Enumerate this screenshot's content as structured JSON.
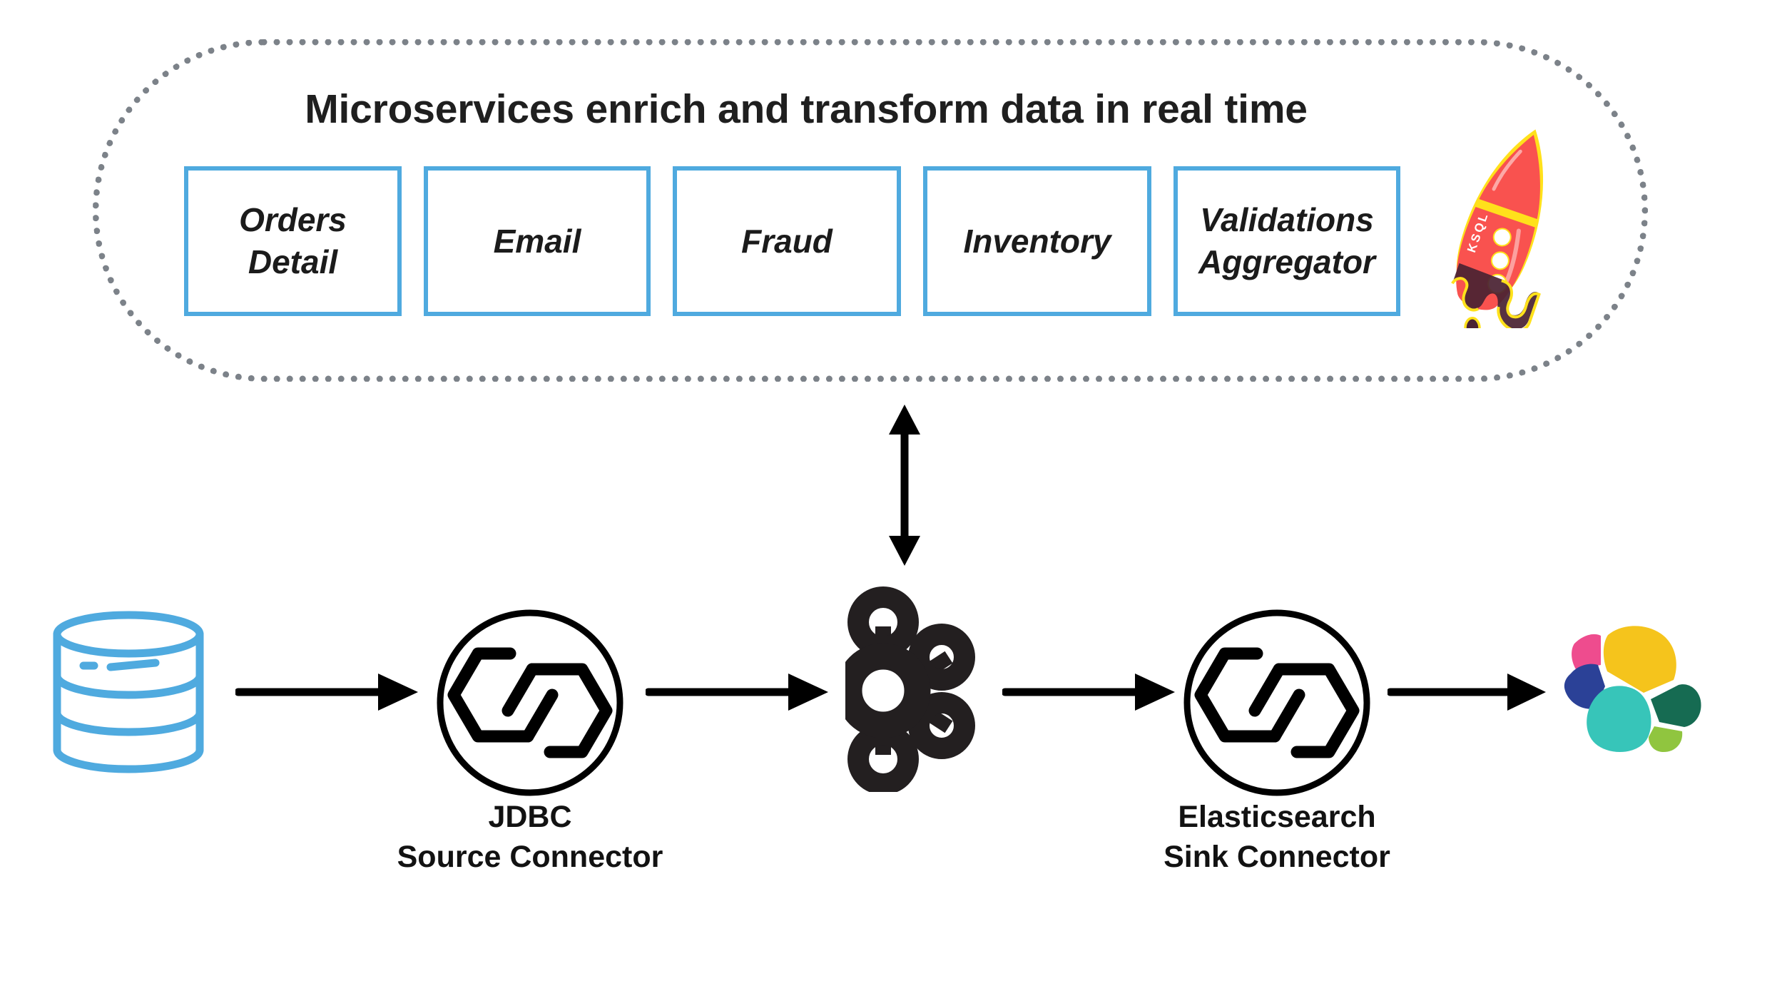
{
  "diagram": {
    "title": "Microservices enrich and transform data in real time",
    "services": [
      {
        "label": "Orders\nDetail",
        "name": "orders-detail"
      },
      {
        "label": "Email",
        "name": "email"
      },
      {
        "label": "Fraud",
        "name": "fraud"
      },
      {
        "label": "Inventory",
        "name": "inventory"
      },
      {
        "label": "Validations\nAggregator",
        "name": "validations-aggregator"
      }
    ],
    "ksql": {
      "icon": "ksql-rocket-icon",
      "label": "KSQL"
    },
    "pipeline": [
      {
        "name": "database",
        "icon": "database-cylinder-icon",
        "caption": ""
      },
      {
        "name": "jdbc-source-connector",
        "icon": "kafka-connect-icon",
        "caption": "JDBC\nSource Connector"
      },
      {
        "name": "kafka",
        "icon": "apache-kafka-icon",
        "caption": ""
      },
      {
        "name": "elasticsearch-sink-connector",
        "icon": "kafka-connect-icon",
        "caption": "Elasticsearch\nSink Connector"
      },
      {
        "name": "elasticsearch",
        "icon": "elasticsearch-icon",
        "caption": ""
      }
    ],
    "captions": {
      "jdbc": "JDBC\nSource Connector",
      "elasticsearch": "Elasticsearch\nSink Connector"
    },
    "colors": {
      "service_border": "#4faadf",
      "database": "#4faadf",
      "dotted_border": "#7c8289",
      "text": "#1b1b1b",
      "arrow": "#000000",
      "rocket_body": "#f9524f",
      "rocket_outline": "#ffe11b",
      "rocket_drip": "#4a2233",
      "es_pink": "#ee4c8e",
      "es_yellow": "#f5c41c",
      "es_blue": "#2b4197",
      "es_teal": "#37c5b9",
      "es_darkgreen": "#166b52",
      "es_lightgreen": "#90c53f"
    }
  }
}
